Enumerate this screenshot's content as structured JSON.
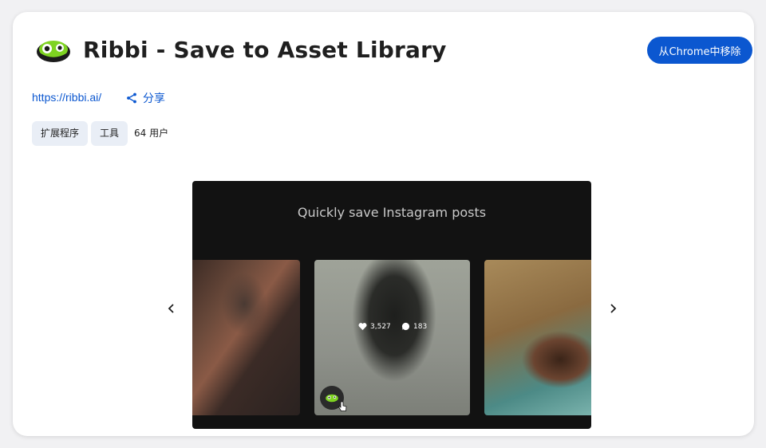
{
  "header": {
    "title": "Ribbi - Save to Asset Library",
    "remove_button": "从Chrome中移除",
    "logo": "ribbi-frog-logo"
  },
  "links": {
    "website": "https://ribbi.ai/",
    "share_label": "分享"
  },
  "tags": {
    "category": "扩展程序",
    "subcategory": "工具",
    "users": "64 用户"
  },
  "screenshot": {
    "caption": "Quickly save Instagram posts",
    "likes": "3,527",
    "comments": "183"
  },
  "colors": {
    "accent": "#0b57d0",
    "chip_bg": "#e9eef6",
    "logo_green": "#7ed321",
    "screenshot_bg": "#121212"
  }
}
